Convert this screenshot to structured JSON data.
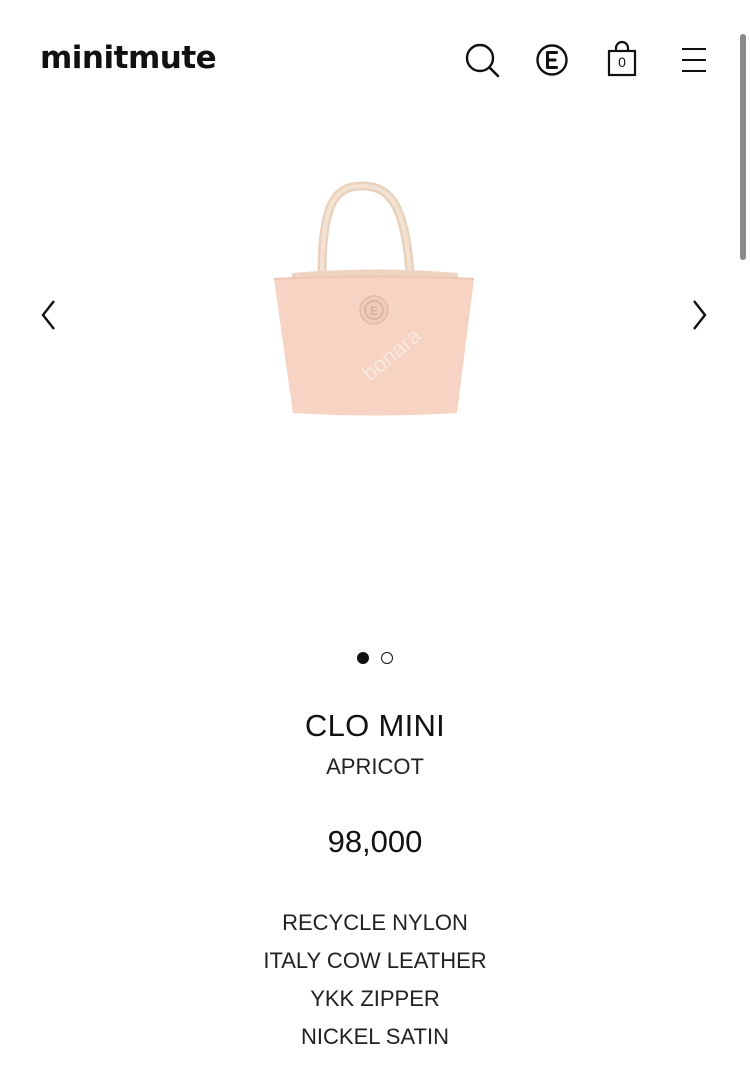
{
  "header": {
    "logo": "minitmute",
    "icons": {
      "search": "search-icon",
      "brand": "e-circle-icon",
      "cart": "shopping-bag-icon",
      "menu": "hamburger-menu-icon"
    },
    "cart_count": "0"
  },
  "carousel": {
    "prev_icon": "chevron-left-icon",
    "next_icon": "chevron-right-icon",
    "image": "apricot-tote-bag",
    "watermark": "bonara",
    "dots_total": 2,
    "active_dot": 1
  },
  "product": {
    "name": "CLO MINI",
    "color": "APRICOT",
    "price": "98,000",
    "features": [
      "RECYCLE NYLON",
      "ITALY COW LEATHER",
      "YKK ZIPPER",
      "NICKEL SATIN"
    ]
  },
  "colors": {
    "text": "#111111",
    "bag": "#f6d3c3",
    "handle": "#eed7c2",
    "background": "#ffffff"
  }
}
